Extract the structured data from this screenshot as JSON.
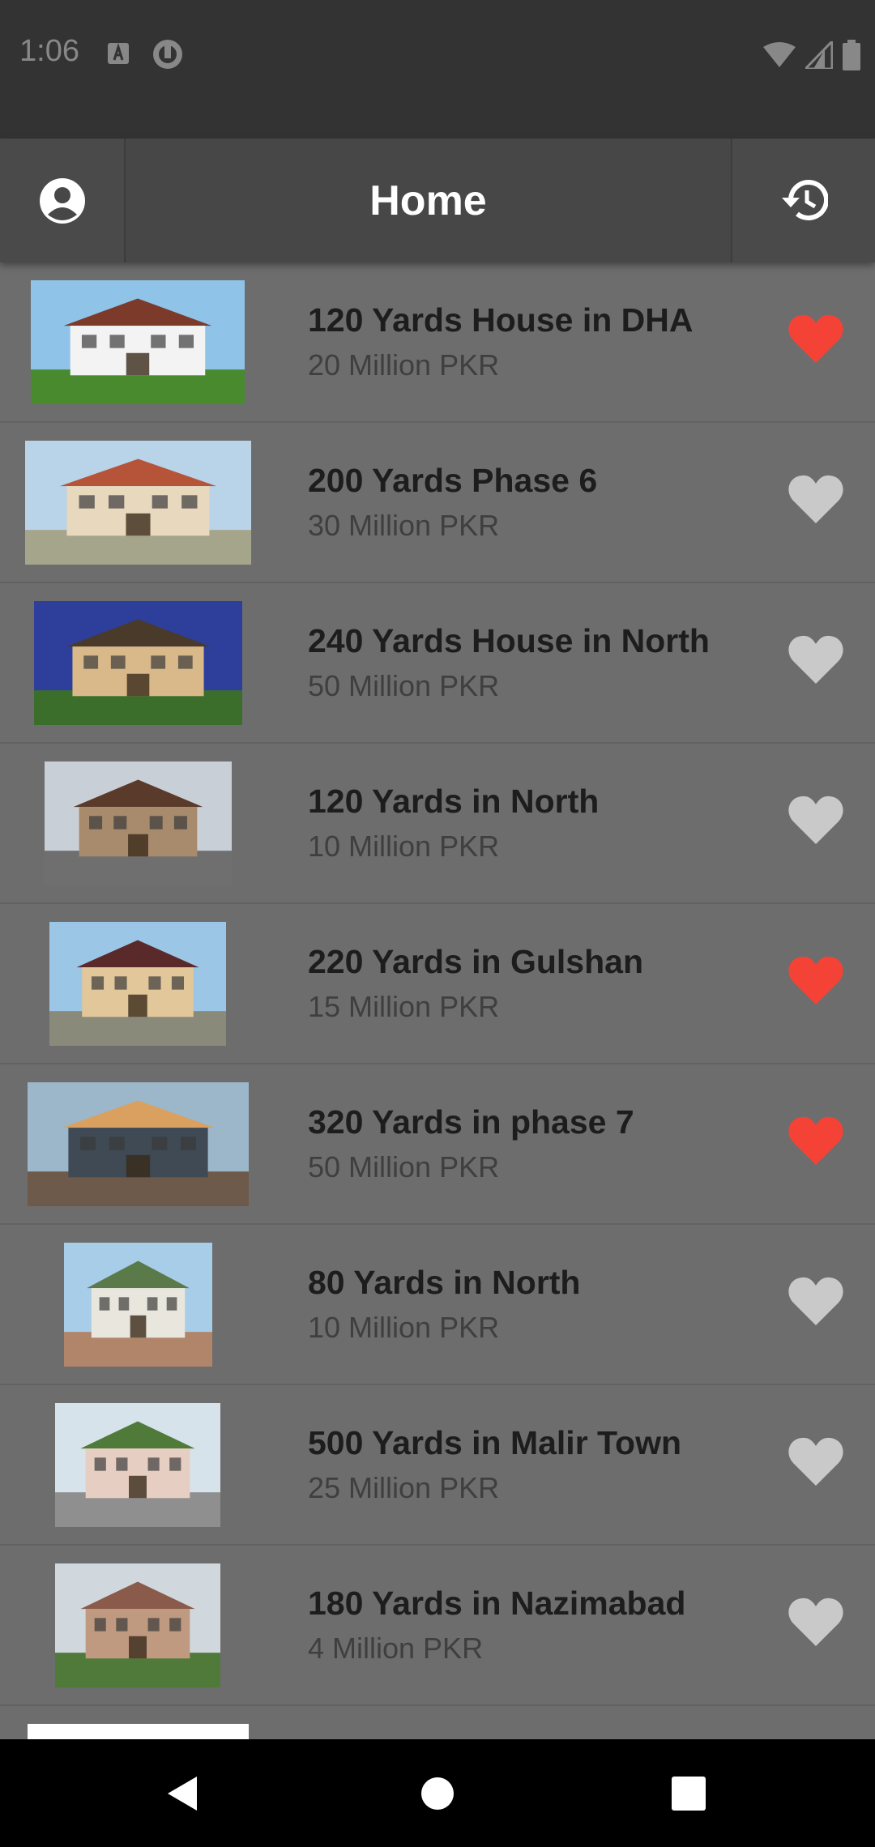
{
  "status_bar": {
    "time": "1:06",
    "left_icons": [
      "a-box-icon",
      "shield-circle-icon"
    ],
    "right_icons": [
      "wifi-icon",
      "signal-icon",
      "battery-icon"
    ]
  },
  "app_bar": {
    "title": "Home",
    "left_icon": "account-circle-icon",
    "right_icon": "history-icon"
  },
  "colors": {
    "favorite_on": "#f44336",
    "favorite_off": "#c9c9c9",
    "list_background": "#6d6d6d",
    "app_bar": "#474747"
  },
  "listings": [
    {
      "title": "120 Yards House in DHA",
      "price": "20 Million PKR",
      "favorite": true
    },
    {
      "title": "200 Yards Phase 6",
      "price": "30 Million PKR",
      "favorite": false
    },
    {
      "title": "240 Yards House in North",
      "price": "50 Million PKR",
      "favorite": false
    },
    {
      "title": "120 Yards in North",
      "price": "10 Million PKR",
      "favorite": false
    },
    {
      "title": "220 Yards in Gulshan",
      "price": "15 Million PKR",
      "favorite": true
    },
    {
      "title": "320 Yards in phase 7",
      "price": "50 Million PKR",
      "favorite": true
    },
    {
      "title": "80 Yards in North",
      "price": "10 Million PKR",
      "favorite": false
    },
    {
      "title": "500 Yards in Malir Town",
      "price": "25 Million PKR",
      "favorite": false
    },
    {
      "title": "180 Yards in Nazimabad",
      "price": "4 Million PKR",
      "favorite": false
    }
  ],
  "nav_bar": {
    "buttons": [
      "back-icon",
      "home-icon",
      "recents-icon"
    ]
  }
}
